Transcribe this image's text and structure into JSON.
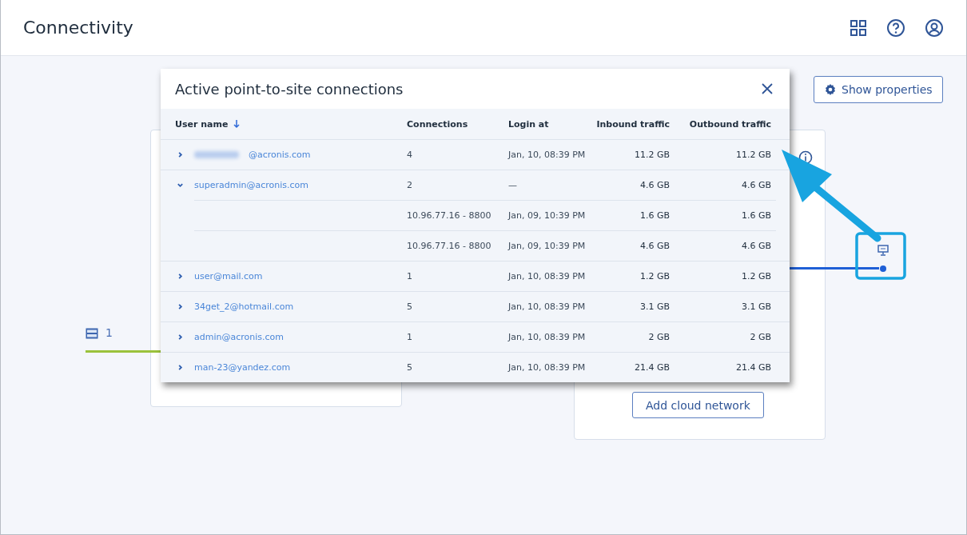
{
  "header": {
    "title": "Connectivity"
  },
  "toolbar": {
    "show_properties": "Show properties"
  },
  "diagram": {
    "node_count": "1",
    "add_cloud_network": "Add cloud network"
  },
  "dialog": {
    "title": "Active point-to-site connections",
    "columns": [
      {
        "label": "User name",
        "sorted": true
      },
      {
        "label": "Connections",
        "sorted": false
      },
      {
        "label": "Login at",
        "sorted": false
      },
      {
        "label": "Inbound traffic",
        "sorted": false
      },
      {
        "label": "Outbound traffic",
        "sorted": false
      }
    ],
    "rows": [
      {
        "user": "@acronis.com",
        "redacted": true,
        "expanded": false,
        "connections": "4",
        "login": "Jan, 10, 08:39 PM",
        "inbound": "11.2 GB",
        "outbound": "11.2 GB"
      },
      {
        "user": "superadmin@acronis.com",
        "redacted": false,
        "expanded": true,
        "connections": "2",
        "login": "—",
        "inbound": "4.6 GB",
        "outbound": "4.6 GB",
        "children": [
          {
            "connections": "10.96.77.16 - 8800",
            "login": "Jan, 09, 10:39 PM",
            "inbound": "1.6 GB",
            "outbound": "1.6 GB"
          },
          {
            "connections": "10.96.77.16 - 8800",
            "login": "Jan, 09, 10:39 PM",
            "inbound": "4.6 GB",
            "outbound": "4.6 GB"
          }
        ]
      },
      {
        "user": "user@mail.com",
        "redacted": false,
        "expanded": false,
        "connections": "1",
        "login": "Jan, 10, 08:39 PM",
        "inbound": "1.2 GB",
        "outbound": "1.2 GB"
      },
      {
        "user": "34get_2@hotmail.com",
        "redacted": false,
        "expanded": false,
        "connections": "5",
        "login": "Jan, 10, 08:39 PM",
        "inbound": "3.1 GB",
        "outbound": "3.1 GB"
      },
      {
        "user": "admin@acronis.com",
        "redacted": false,
        "expanded": false,
        "connections": "1",
        "login": "Jan, 10, 08:39 PM",
        "inbound": "2 GB",
        "outbound": "2 GB"
      },
      {
        "user": "man-23@yandez.com",
        "redacted": false,
        "expanded": false,
        "connections": "5",
        "login": "Jan, 10, 08:39 PM",
        "inbound": "21.4 GB",
        "outbound": "21.4 GB"
      }
    ]
  }
}
